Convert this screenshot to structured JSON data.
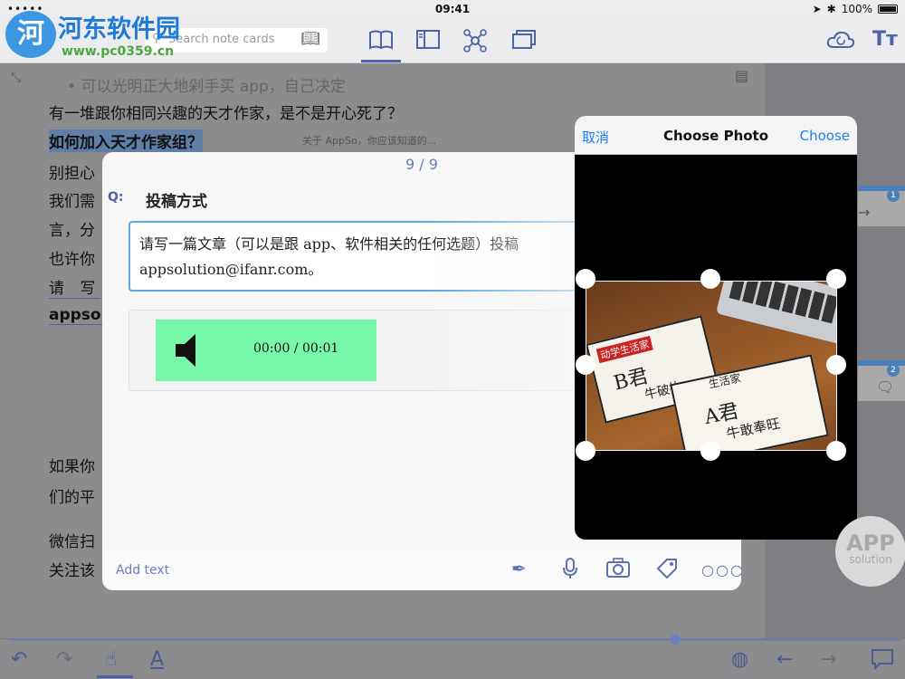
{
  "status": {
    "carrier": "•••••",
    "time": "09:41",
    "battery": "100%",
    "bluetooth": "✱",
    "location": "➤"
  },
  "watermark": {
    "title": "河东软件园",
    "url": "www.pc0359.cn",
    "logo": "河"
  },
  "toolbar": {
    "search_placeholder": "Search note cards",
    "tabs": [
      "reader-icon",
      "sidebar-icon",
      "mindmap-icon",
      "cards-icon"
    ],
    "right_icons": [
      "cloud-sync-icon",
      "text-size-icon"
    ]
  },
  "note": {
    "breadcrumb": "关于 AppSo，你应该知道的...",
    "bullet": "可以光明正大地剁手买 app，自己决定",
    "lines": [
      "有一堆跟你相同兴趣的天才作家，是不是开心死了？",
      "如何加入天才作家组？",
      "别担心",
      "我们需",
      "言，分",
      "也许你",
      "请 写",
      "appsol",
      "如果你",
      "们的平",
      "微信扫",
      "关注该"
    ],
    "side_counts": [
      "1",
      "2"
    ]
  },
  "card": {
    "pager": "9 / 9",
    "q_label": "Q:",
    "question": "投稿方式",
    "answer": "请写一篇文章（可以是跟 app、软件相关的任何选题）投稿\nappsolution@ifanr.com。",
    "audio_time": "00:00 / 00:01",
    "add_text": "Add text"
  },
  "picker": {
    "cancel": "取消",
    "title": "Choose Photo",
    "choose": "Choose",
    "card1_brand": "动学生活家",
    "card1_text": "B君",
    "card1_sub": "牛破执",
    "card2_brand": "生活家",
    "card2_text": "A君",
    "card2_sub": "牛敢奉旺"
  },
  "badge": {
    "line1": "APP",
    "line2": "solution"
  },
  "colors": {
    "accent": "#4c63a8",
    "link": "#1a7ff0",
    "audio_bg": "#78f7a8"
  }
}
